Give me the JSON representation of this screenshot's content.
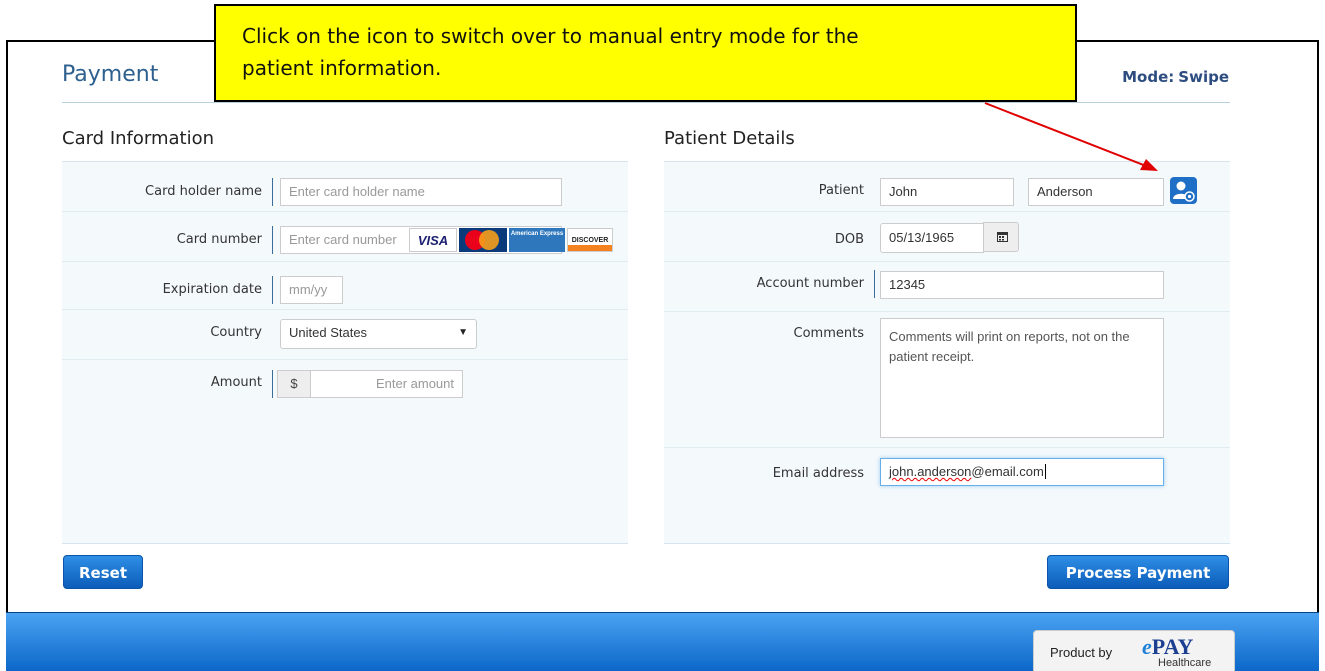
{
  "header": {
    "title": "Payment",
    "mode_label": "Mode:",
    "mode_value": "Swipe"
  },
  "callout": {
    "line1": "Click on the icon to switch over to manual entry mode for the",
    "line2": "patient information."
  },
  "card_info": {
    "heading": "Card Information",
    "holder_label": "Card holder name",
    "holder_placeholder": "Enter card holder name",
    "number_label": "Card number",
    "number_placeholder": "Enter card number",
    "card_brands": [
      "VISA",
      "MasterCard",
      "American Express",
      "DISCOVER"
    ],
    "exp_label": "Expiration date",
    "exp_placeholder": "mm/yy",
    "country_label": "Country",
    "country_value": "United States",
    "amount_label": "Amount",
    "amount_prefix": "$",
    "amount_placeholder": "Enter amount"
  },
  "patient": {
    "heading": "Patient Details",
    "patient_label": "Patient",
    "first_name": "John",
    "last_name": "Anderson",
    "manual_entry_icon": "user-edit-icon",
    "dob_label": "DOB",
    "dob_value": "05/13/1965",
    "calendar_icon": "calendar-icon",
    "account_label": "Account number",
    "account_value": "12345",
    "comments_label": "Comments",
    "comments_value": "Comments will print on reports, not on the patient receipt.",
    "email_label": "Email address",
    "email_user": "john.anderson",
    "email_domain": "@email.com"
  },
  "buttons": {
    "reset": "Reset",
    "process": "Process Payment"
  },
  "footer": {
    "product_by": "Product by",
    "brand_e": "e",
    "brand_pay": "PAY",
    "brand_sub": "Healthcare"
  },
  "colors": {
    "accent": "#0b5cb8",
    "callout": "#ffff00",
    "title": "#2d5f8f",
    "arrow": "#e00000"
  }
}
